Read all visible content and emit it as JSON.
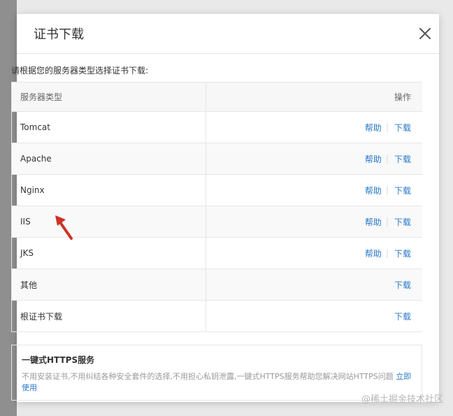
{
  "dialog": {
    "title": "证书下载",
    "intro": "请根据您的服务器类型选择证书下载:"
  },
  "table": {
    "col_type": "服务器类型",
    "col_ops": "操作",
    "help_label": "帮助",
    "download_label": "下载",
    "rows": [
      {
        "type": "Tomcat",
        "has_help": true
      },
      {
        "type": "Apache",
        "has_help": true
      },
      {
        "type": "Nginx",
        "has_help": true
      },
      {
        "type": "IIS",
        "has_help": true
      },
      {
        "type": "JKS",
        "has_help": true
      },
      {
        "type": "其他",
        "has_help": false
      },
      {
        "type": "根证书下载",
        "has_help": false
      }
    ]
  },
  "promo": {
    "title": "一键式HTTPS服务",
    "desc": "不用安装证书,不用纠结各种安全套件的选择,不用担心私钥泄露,一键式HTTPS服务帮助您解决网站HTTPS问题",
    "cta": "立即使用"
  },
  "watermark": "@稀土掘金技术社区",
  "colors": {
    "link": "#2979c9",
    "arrow": "#cc3326"
  }
}
